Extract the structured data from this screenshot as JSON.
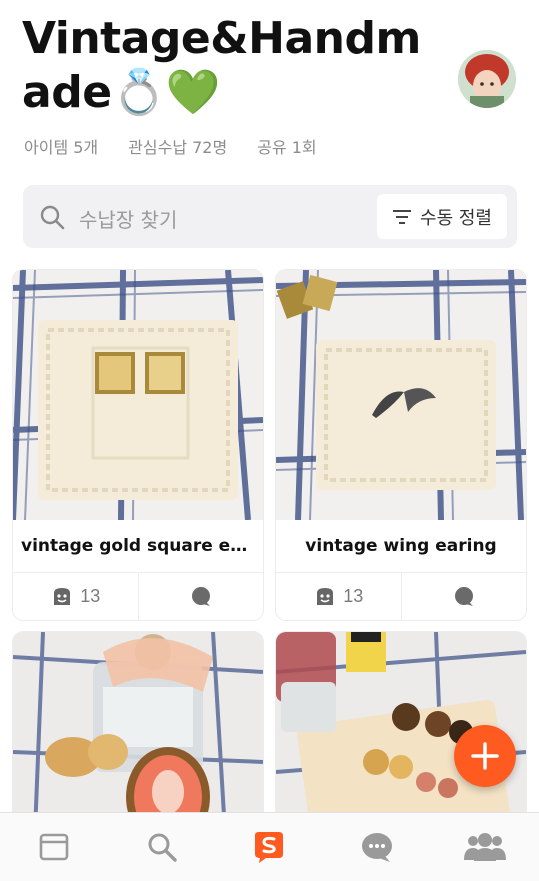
{
  "header": {
    "title": "Vintage&Handmade💍💚",
    "stats": [
      "아이템 5개",
      "관심수납 72명",
      "공유 1회"
    ]
  },
  "search": {
    "placeholder": "수납장 찾기",
    "sort_label": "수동 정렬"
  },
  "cards": [
    {
      "name": "vintage gold square ea...",
      "likes": "13"
    },
    {
      "name": "vintage wing earing",
      "likes": "13"
    },
    {
      "name": "",
      "likes": ""
    },
    {
      "name": "",
      "likes": ""
    }
  ],
  "tabbar": {
    "items": [
      "feed-icon",
      "search-icon",
      "styleshare-logo-icon",
      "chat-icon",
      "people-icon"
    ]
  },
  "colors": {
    "accent": "#ff5a1f",
    "icon_gray": "#9a9a9a"
  }
}
